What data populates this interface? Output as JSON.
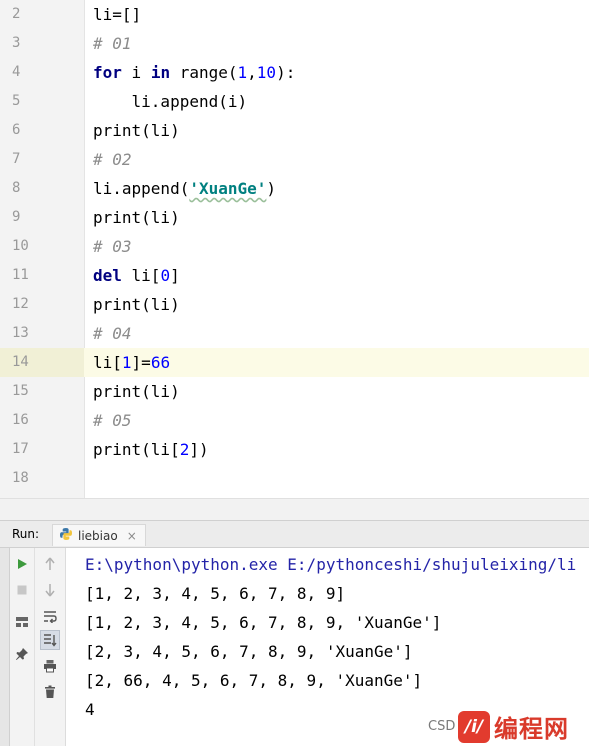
{
  "editor": {
    "current_line": "14",
    "lines": [
      {
        "n": "2",
        "t": [
          {
            "c": "plain",
            "v": "li=[]"
          }
        ]
      },
      {
        "n": "3",
        "t": [
          {
            "c": "cm",
            "v": "# 01"
          }
        ]
      },
      {
        "n": "4",
        "t": [
          {
            "c": "kw",
            "v": "for"
          },
          {
            "c": "plain",
            "v": " i "
          },
          {
            "c": "kw",
            "v": "in"
          },
          {
            "c": "plain",
            "v": " range("
          },
          {
            "c": "num",
            "v": "1"
          },
          {
            "c": "plain",
            "v": ","
          },
          {
            "c": "num",
            "v": "10"
          },
          {
            "c": "plain",
            "v": "):"
          }
        ]
      },
      {
        "n": "5",
        "t": [
          {
            "c": "plain",
            "v": "    li.append(i)"
          }
        ]
      },
      {
        "n": "6",
        "t": [
          {
            "c": "plain",
            "v": "print(li)"
          }
        ]
      },
      {
        "n": "7",
        "t": [
          {
            "c": "cm",
            "v": "# 02"
          }
        ]
      },
      {
        "n": "8",
        "t": [
          {
            "c": "plain",
            "v": "li.append("
          },
          {
            "c": "str",
            "v": "'XuanGe'"
          },
          {
            "c": "plain",
            "v": ")"
          }
        ]
      },
      {
        "n": "9",
        "t": [
          {
            "c": "plain",
            "v": "print(li)"
          }
        ]
      },
      {
        "n": "10",
        "t": [
          {
            "c": "cm",
            "v": "# 03"
          }
        ]
      },
      {
        "n": "11",
        "t": [
          {
            "c": "kw",
            "v": "del"
          },
          {
            "c": "plain",
            "v": " li["
          },
          {
            "c": "num",
            "v": "0"
          },
          {
            "c": "plain",
            "v": "]"
          }
        ]
      },
      {
        "n": "12",
        "t": [
          {
            "c": "plain",
            "v": "print(li)"
          }
        ]
      },
      {
        "n": "13",
        "t": [
          {
            "c": "cm",
            "v": "# 04"
          }
        ]
      },
      {
        "n": "14",
        "t": [
          {
            "c": "plain",
            "v": "li["
          },
          {
            "c": "num",
            "v": "1"
          },
          {
            "c": "plain",
            "v": "]="
          },
          {
            "c": "num",
            "v": "66"
          }
        ]
      },
      {
        "n": "15",
        "t": [
          {
            "c": "plain",
            "v": "print(li)"
          }
        ]
      },
      {
        "n": "16",
        "t": [
          {
            "c": "cm",
            "v": "# 05"
          }
        ]
      },
      {
        "n": "17",
        "t": [
          {
            "c": "plain",
            "v": "print(li["
          },
          {
            "c": "num",
            "v": "2"
          },
          {
            "c": "plain",
            "v": "])"
          }
        ]
      },
      {
        "n": "18",
        "t": []
      }
    ]
  },
  "run_panel": {
    "label": "Run:",
    "tab_label": "liebiao",
    "tab_close": "×",
    "output": [
      "E:\\python\\python.exe E:/pythonceshi/shujuleixing/li",
      "[1, 2, 3, 4, 5, 6, 7, 8, 9]",
      "[1, 2, 3, 4, 5, 6, 7, 8, 9, 'XuanGe']",
      "[2, 3, 4, 5, 6, 7, 8, 9, 'XuanGe']",
      "[2, 66, 4, 5, 6, 7, 8, 9, 'XuanGe']",
      "4"
    ],
    "toolbar_icons": [
      "run-icon",
      "stop-icon",
      "up-arrow-icon",
      "down-arrow-icon",
      "soft-wrap-icon",
      "scroll-to-end-icon",
      "layout-icon",
      "pin-icon",
      "print-icon",
      "trash-icon"
    ]
  },
  "watermark": {
    "text": "CSD",
    "logo": "编程网"
  },
  "colors": {
    "keyword": "#000080",
    "number": "#0000ff",
    "comment": "#8c8c8c",
    "string": "#008080",
    "current_line": "#fcfbe6",
    "run_icon": "#3d9a3d"
  }
}
